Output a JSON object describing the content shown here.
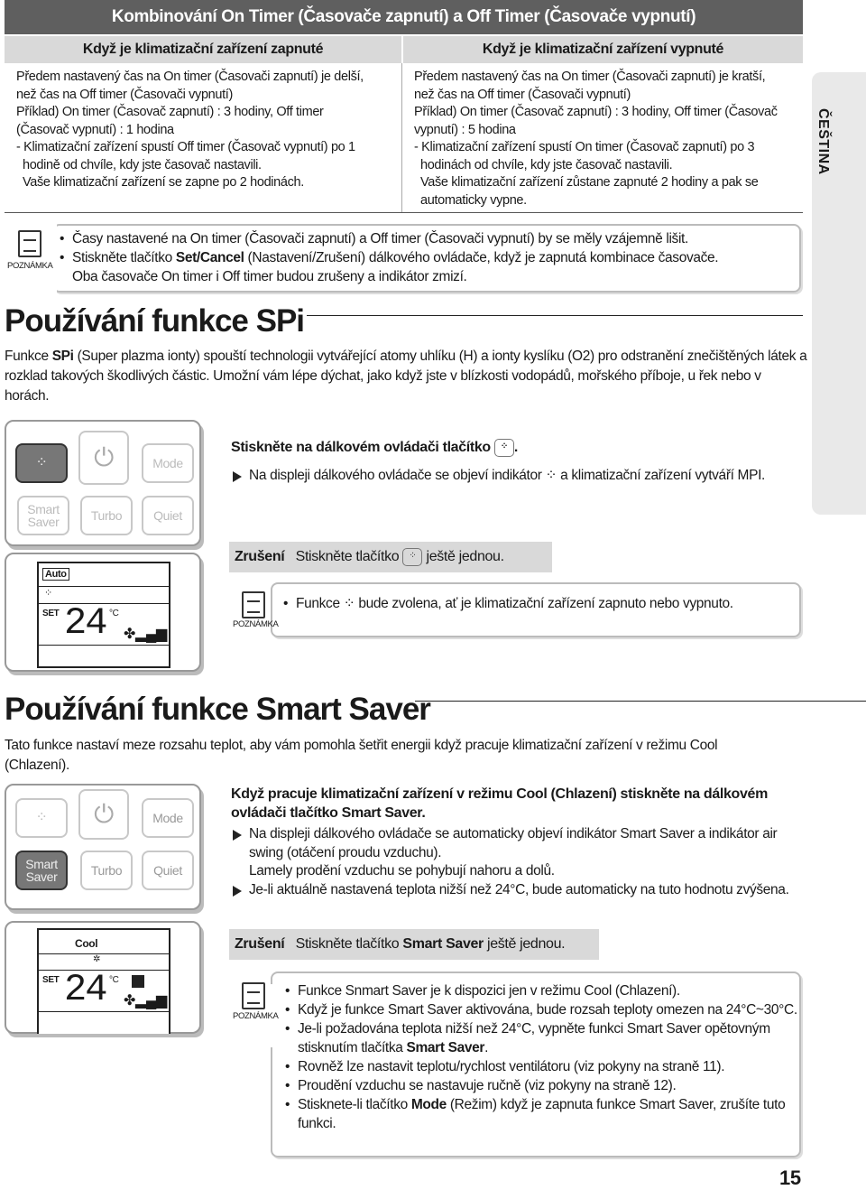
{
  "table": {
    "title": "Kombinování On Timer (Časovače zapnutí) a Off Timer (Časovače vypnutí)",
    "left_header": "Když je klimatizační zařízení zapnuté",
    "right_header": "Když je klimatizační zařízení vypnuté",
    "left_lines": [
      "Předem nastavený čas na On timer (Časovači zapnutí) je delší,",
      "než čas na Off timer (Časovači vypnutí)",
      "Příklad) On timer (Časovač zapnutí) : 3 hodiny, Off timer",
      "(Časovač vypnutí) : 1 hodina",
      "- Klimatizační zařízení spustí Off timer (Časovač vypnutí) po 1",
      "hodině od chvíle, kdy jste časovač nastavili.",
      "Vaše klimatizační zařízení se zapne po 2 hodinách."
    ],
    "right_lines": [
      "Předem nastavený čas na On timer (Časovači zapnutí) je kratší,",
      "než čas na Off timer (Časovači vypnutí)",
      "Příklad) On timer (Časovač zapnutí) : 3 hodiny, Off timer (Časovač",
      "vypnutí) : 5 hodina",
      "- Klimatizační zařízení spustí On timer (Časovač zapnutí) po 3",
      "hodinách od chvíle, kdy jste časovač nastavili.",
      "Vaše klimatizační zařízení zůstane zapnuté 2 hodiny a pak se",
      "automaticky vypne."
    ]
  },
  "note_label": "POZNÁMKA",
  "note1": [
    "Časy nastavené na On timer (Časovači zapnutí) a Off timer (Časovači vypnutí) by se měly vzájemně lišit.",
    "Stiskněte tlačítko ",
    "Set/Cancel",
    " (Nastavení/Zrušení) dálkového ovládače, když je zapnutá kombinace časovače.",
    "Oba časovače On timer i Off timer budou zrušeny a indikátor zmizí."
  ],
  "spi": {
    "title": "Používání funkce SPi",
    "para_a": "Funkce ",
    "para_bold": "SPi",
    "para_b": " (Super plazma ionty) spouští technologii vytvářející atomy uhlíku (H) a ionty kyslíku (O2) pro odstranění znečištěných látek a rozklad takových škodlivých částic. Umožní vám lépe dýchat, jako když jste v blízkosti vodopádů, mořského příboje, u řek nebo v horách.",
    "step": "Stiskněte na dálkovém ovládači tlačítko",
    "bullet_a": "Na displeji dálkového ovládače se objeví indikátor",
    "bullet_b": "a klimatizační zařízení vytváří MPI.",
    "cancel_label": "Zrušení",
    "cancel_a": "Stiskněte tlačítko",
    "cancel_b": "ještě jednou.",
    "note_a": "Funkce",
    "note_b": "bude zvolena, ať je klimatizační zařízení zapnuto nebo vypnuto."
  },
  "remote": {
    "mode": "Mode",
    "smart": "Smart",
    "saver": "Saver",
    "turbo": "Turbo",
    "quiet": "Quiet",
    "auto": "Auto",
    "cool": "Cool",
    "set": "SET",
    "temp": "24",
    "unit": "°C"
  },
  "smart": {
    "title": "Používání funkce Smart Saver",
    "para": "Tato funkce nastaví meze rozsahu teplot, aby vám pomohla šetřit energii když pracuje klimatizační zařízení v režimu Cool (Chlazení).",
    "step_a": "Když pracuje klimatizační zařízení v režimu Cool (Chlazení) stiskněte na dálkovém ovládači tlačítko ",
    "step_b": "Smart Saver",
    ".": ".",
    "bullets": [
      "Na displeji dálkového ovládače se automaticky objeví indikátor Smart Saver a indikátor air swing (otáčení proudu vzduchu).",
      "Lamely prodění vzduchu se pohybují nahoru a dolů.",
      "Je-li aktuálně nastavená teplota nižší než 24°C, bude automaticky na tuto hodnotu zvýšena."
    ],
    "cancel_label": "Zrušení",
    "cancel_a": "Stiskněte tlačítko ",
    "cancel_bold": "Smart Saver",
    "cancel_b": " ještě jednou.",
    "notes": [
      "Funkce Snmart Saver je k dispozici jen v režimu Cool (Chlazení).",
      "Když je funkce Smart Saver aktivována, bude rozsah teploty omezen na 24°C~30°C.",
      "Je-li požadována teplota nižší než 24°C, vypněte funkci Smart Saver opětovným stisknutím tlačítka ",
      "Smart Saver",
      ".",
      "Rovněž lze nastavit teplotu/rychlost ventilátoru (viz pokyny na straně 11).",
      "Proudění vzduchu se nastavuje ručně (viz pokyny na straně 12).",
      "Stisknete-li tlačítko ",
      "Mode",
      " (Režim) když je zapnuta funkce Smart Saver, zrušíte tuto funkci."
    ]
  },
  "side_tab": "ČEŠTINA",
  "page_number": "15"
}
